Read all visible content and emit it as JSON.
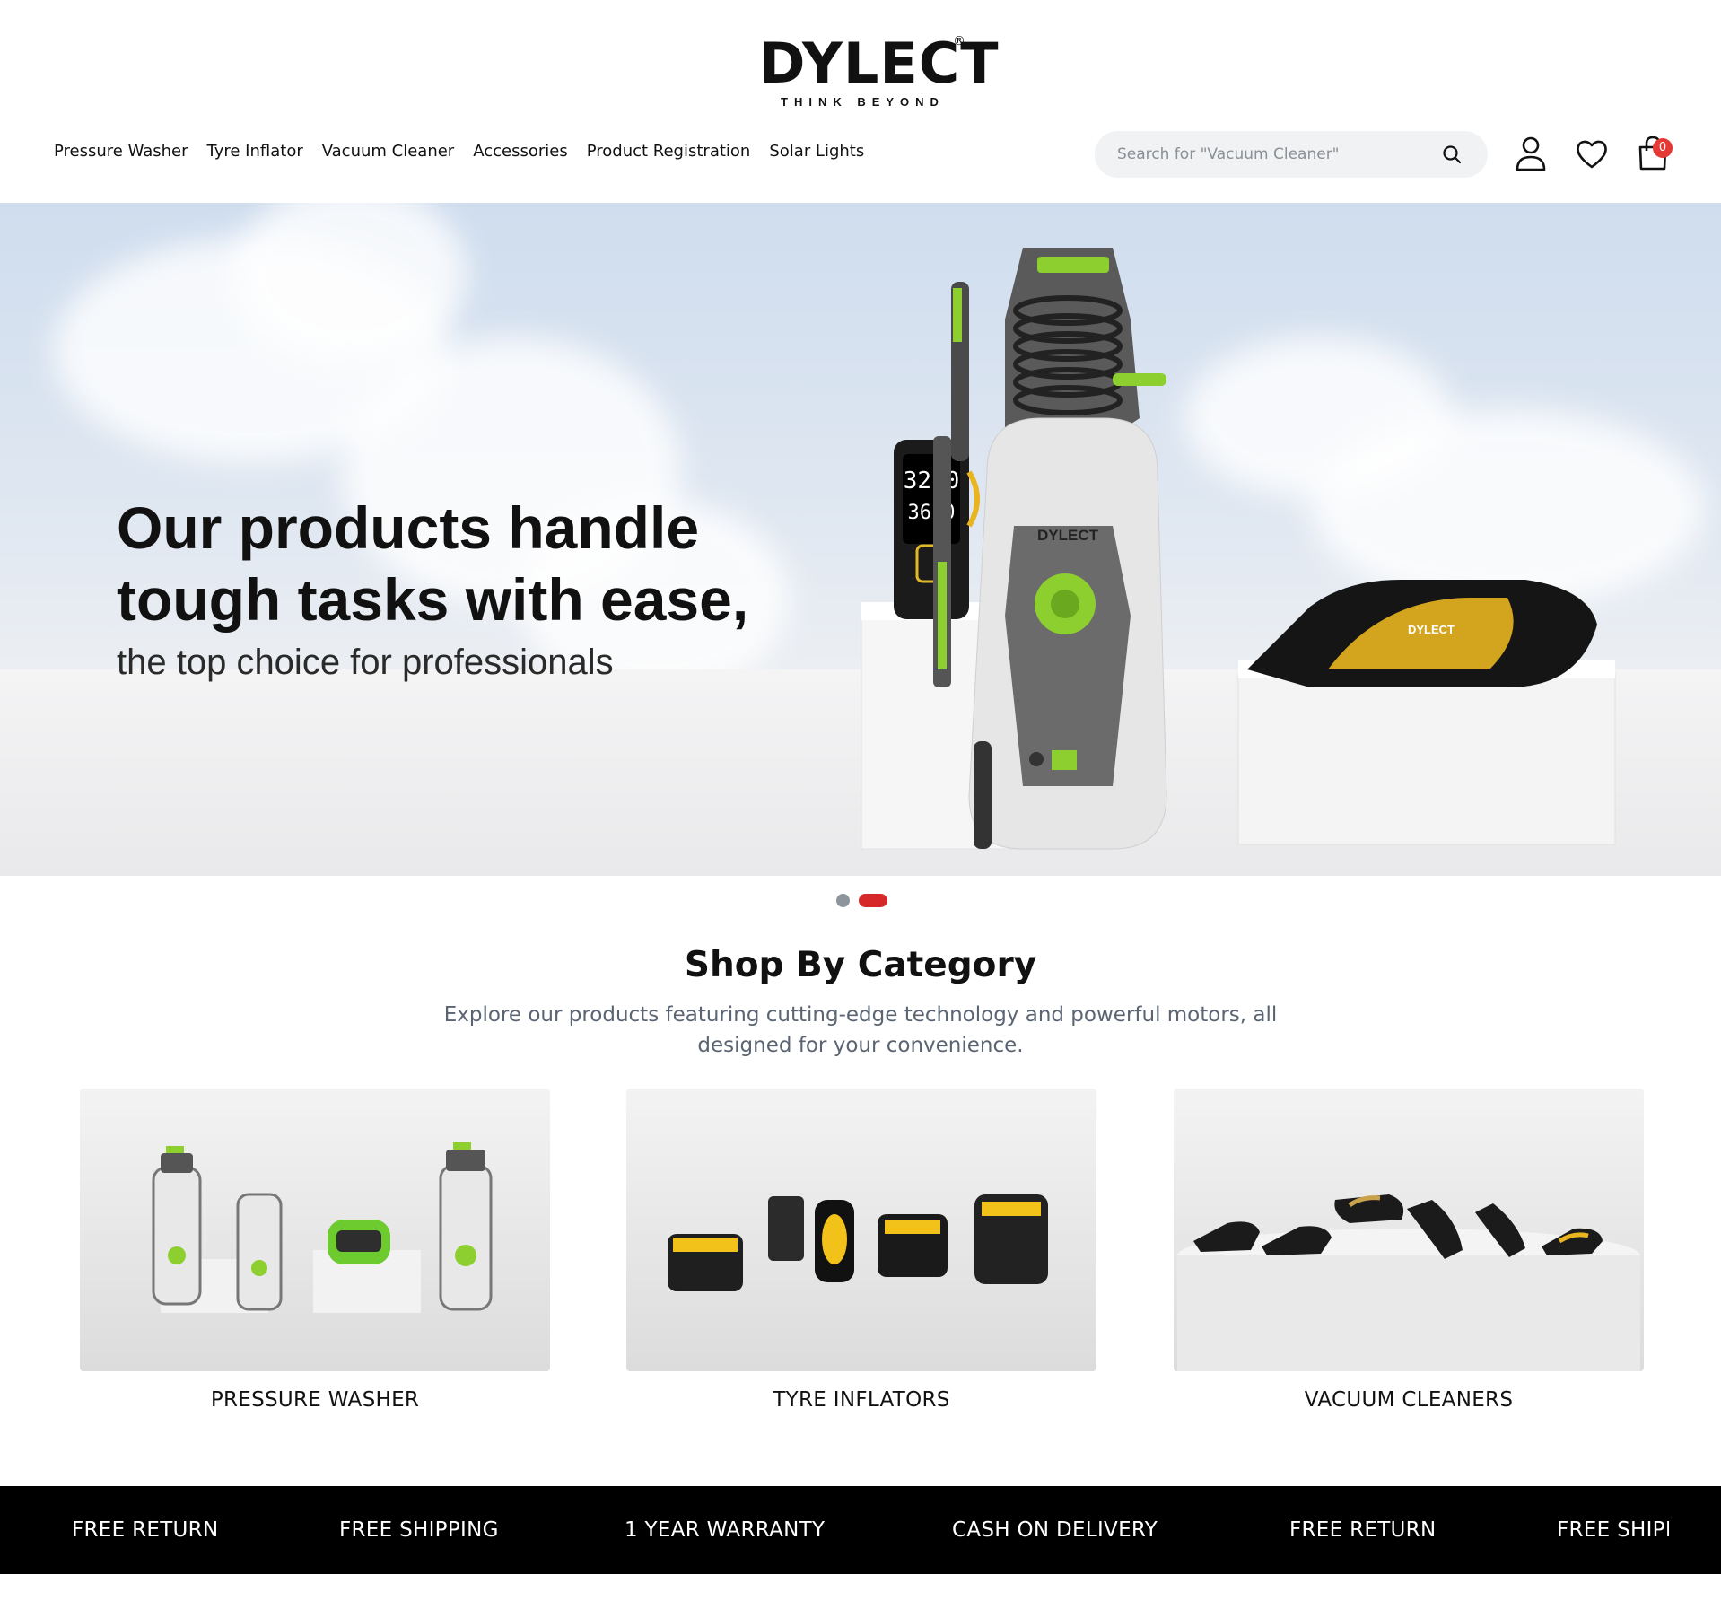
{
  "brand": {
    "name": "DYLECT",
    "tagline": "THINK BEYOND",
    "registered": "®"
  },
  "nav": {
    "items": [
      "Pressure Washer",
      "Tyre Inflator",
      "Vacuum Cleaner",
      "Accessories",
      "Product Registration",
      "Solar Lights"
    ]
  },
  "search": {
    "placeholder": "Search for \"Vacuum Cleaner\""
  },
  "header_icons": [
    "user-icon",
    "heart-icon",
    "cart-icon"
  ],
  "cart": {
    "count": "0"
  },
  "hero": {
    "headline": "Our products handle tough tasks with ease,",
    "subheadline": "the top choice for professionals",
    "slides": 2,
    "active_slide": 2,
    "device": {
      "display_top": "32.0",
      "display_bottom": "36.0",
      "brand_mark": "DYLECT"
    }
  },
  "category": {
    "title": "Shop By Category",
    "description": "Explore our products featuring cutting-edge technology and powerful motors, all designed for your convenience.",
    "cards": [
      {
        "label": "PRESSURE WASHER"
      },
      {
        "label": "TYRE INFLATORS"
      },
      {
        "label": "VACUUM CLEANERS"
      }
    ]
  },
  "features": {
    "items": [
      "FREE RETURN",
      "FREE SHIPPING",
      "1 YEAR WARRANTY",
      "CASH ON DELIVERY",
      "FREE RETURN",
      "FREE SHIPPING"
    ]
  },
  "colors": {
    "accent": "#d62828",
    "badge": "#e53935",
    "lime": "#9bd82c",
    "bar": "#000000"
  }
}
